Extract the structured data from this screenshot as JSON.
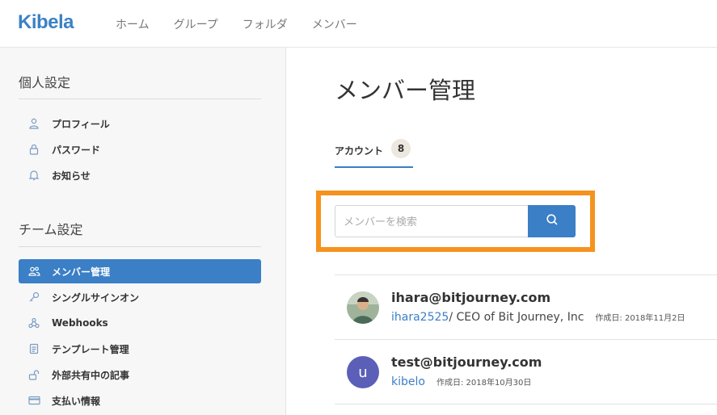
{
  "header": {
    "logo": "Kibela",
    "nav": [
      "ホーム",
      "グループ",
      "フォルダ",
      "メンバー"
    ]
  },
  "sidebar": {
    "personal_title": "個人設定",
    "personal_items": [
      {
        "label": "プロフィール",
        "icon": "user-icon"
      },
      {
        "label": "パスワード",
        "icon": "lock-icon"
      },
      {
        "label": "お知らせ",
        "icon": "bell-icon"
      }
    ],
    "team_title": "チーム設定",
    "team_items": [
      {
        "label": "メンバー管理",
        "icon": "users-icon",
        "active": true
      },
      {
        "label": "シングルサインオン",
        "icon": "key-icon"
      },
      {
        "label": "Webhooks",
        "icon": "webhook-icon"
      },
      {
        "label": "テンプレート管理",
        "icon": "document-icon"
      },
      {
        "label": "外部共有中の記事",
        "icon": "unlock-icon"
      },
      {
        "label": "支払い情報",
        "icon": "credit-card-icon"
      }
    ]
  },
  "main": {
    "title": "メンバー管理",
    "tab": {
      "label": "アカウント",
      "count": "8"
    },
    "search": {
      "placeholder": "メンバーを検索"
    },
    "members": [
      {
        "email": "ihara@bitjourney.com",
        "handle": "ihara2525",
        "title": " / CEO of Bit Journey, Inc",
        "created": "作成日: 2018年11月2日"
      },
      {
        "email": "test@bitjourney.com",
        "handle": "kibelo",
        "title": "",
        "created": "作成日: 2018年10月30日",
        "avatar_letter": "u"
      }
    ]
  },
  "colors": {
    "accent": "#3b7fc6",
    "highlight": "#f6921e",
    "avatar_bg": "#5b5fb8"
  }
}
